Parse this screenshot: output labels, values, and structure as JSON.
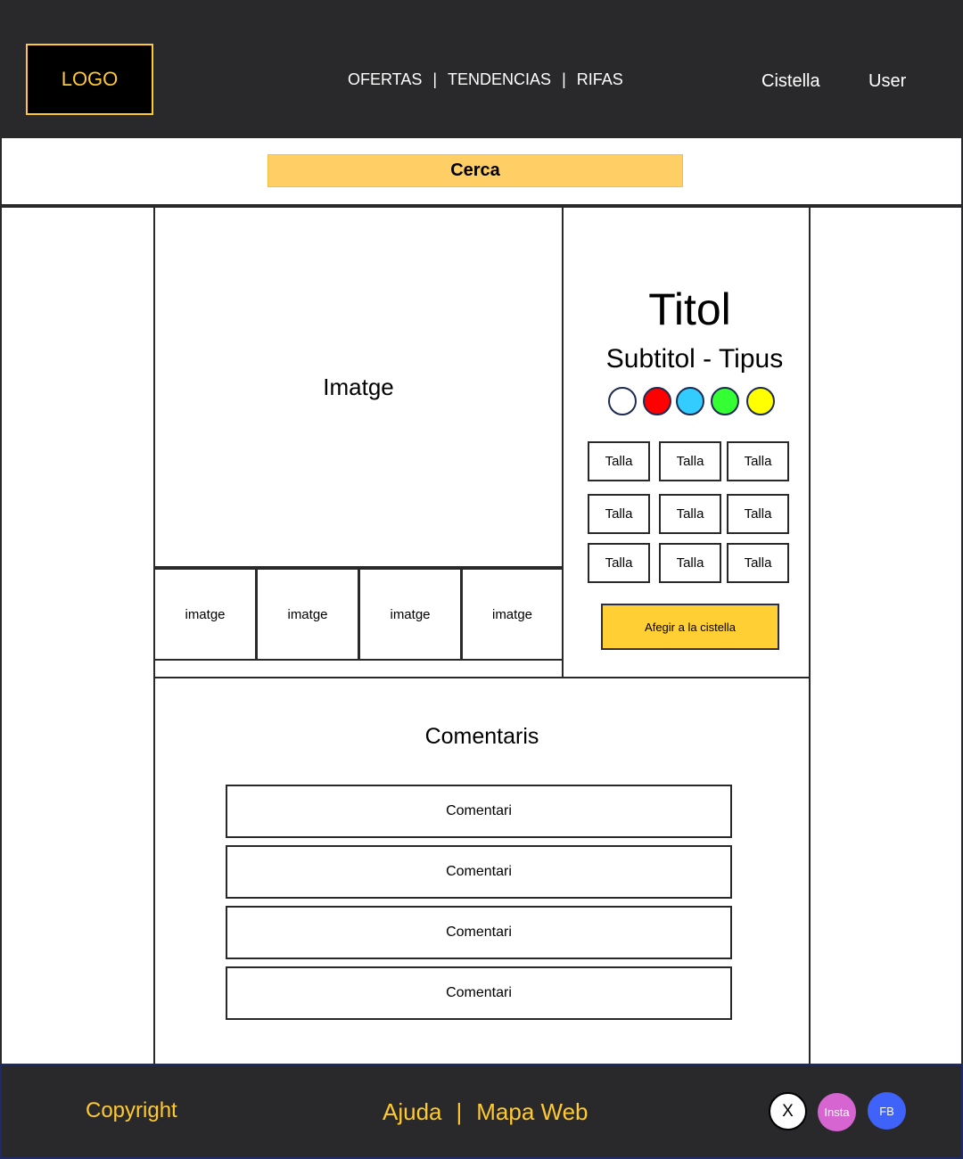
{
  "header": {
    "logo": "LOGO",
    "nav": [
      {
        "label": "OFERTAS"
      },
      {
        "label": "TENDENCIAS"
      },
      {
        "label": "RIFAS"
      }
    ],
    "nav_separator": "|",
    "basket": "Cistella",
    "user": "User"
  },
  "search": {
    "label": "Cerca"
  },
  "product": {
    "main_image": "Imatge",
    "thumbnails": [
      "imatge",
      "imatge",
      "imatge",
      "imatge"
    ],
    "title": "Titol",
    "subtitle": "Subtitol - Tipus",
    "colors": [
      "#ffffff",
      "#ff0000",
      "#33ccff",
      "#33ff33",
      "#ffff00"
    ],
    "sizes": [
      "Talla",
      "Talla",
      "Talla",
      "Talla",
      "Talla",
      "Talla",
      "Talla",
      "Talla",
      "Talla"
    ],
    "add_to_basket": "Afegir a la cistella"
  },
  "comments": {
    "title": "Comentaris",
    "items": [
      "Comentari",
      "Comentari",
      "Comentari",
      "Comentari"
    ]
  },
  "footer": {
    "copyright": "Copyright",
    "links": [
      {
        "label": "Ajuda"
      },
      {
        "label": "Mapa Web"
      }
    ],
    "links_separator": "|",
    "social": {
      "x": "X",
      "insta": "Insta",
      "fb": "FB"
    }
  },
  "colors": {
    "dark": "#29292b",
    "accent": "#ffc930",
    "search_bg": "#ffcf66",
    "button_bg": "#ffcf33"
  }
}
